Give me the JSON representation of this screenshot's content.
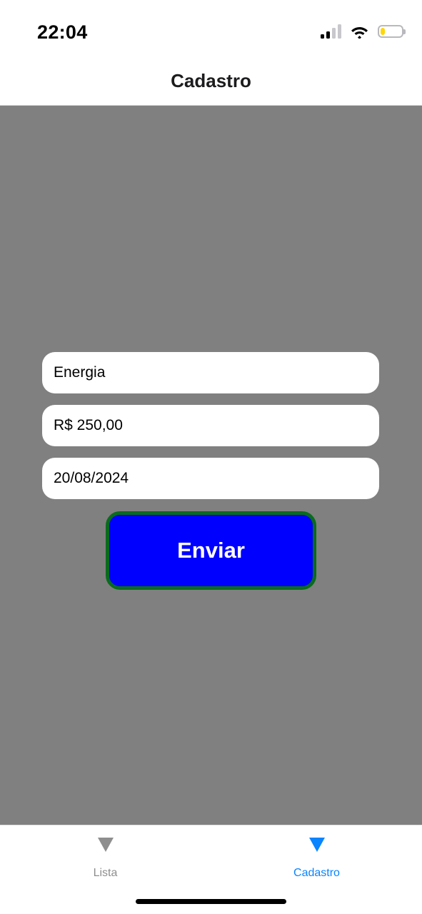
{
  "status_bar": {
    "time": "22:04",
    "signal_icon": "cellular-signal-icon",
    "wifi_icon": "wifi-icon",
    "battery_icon": "battery-icon",
    "battery_level": 0.2,
    "battery_color": "#ffd60a"
  },
  "header": {
    "title": "Cadastro"
  },
  "form": {
    "descricao_value": "Energia",
    "valor_value": "R$ 250,00",
    "data_value": "20/08/2024",
    "submit_label": "Enviar",
    "submit_color": "#0000ff",
    "submit_border_color": "#0a6b1e",
    "background_color": "#808080"
  },
  "tab_bar": {
    "tabs": [
      {
        "label": "Lista",
        "icon": "triangle-down-icon",
        "active": false,
        "color": "#8e8e8e"
      },
      {
        "label": "Cadastro",
        "icon": "triangle-down-icon",
        "active": true,
        "color": "#0a84ff"
      }
    ]
  }
}
